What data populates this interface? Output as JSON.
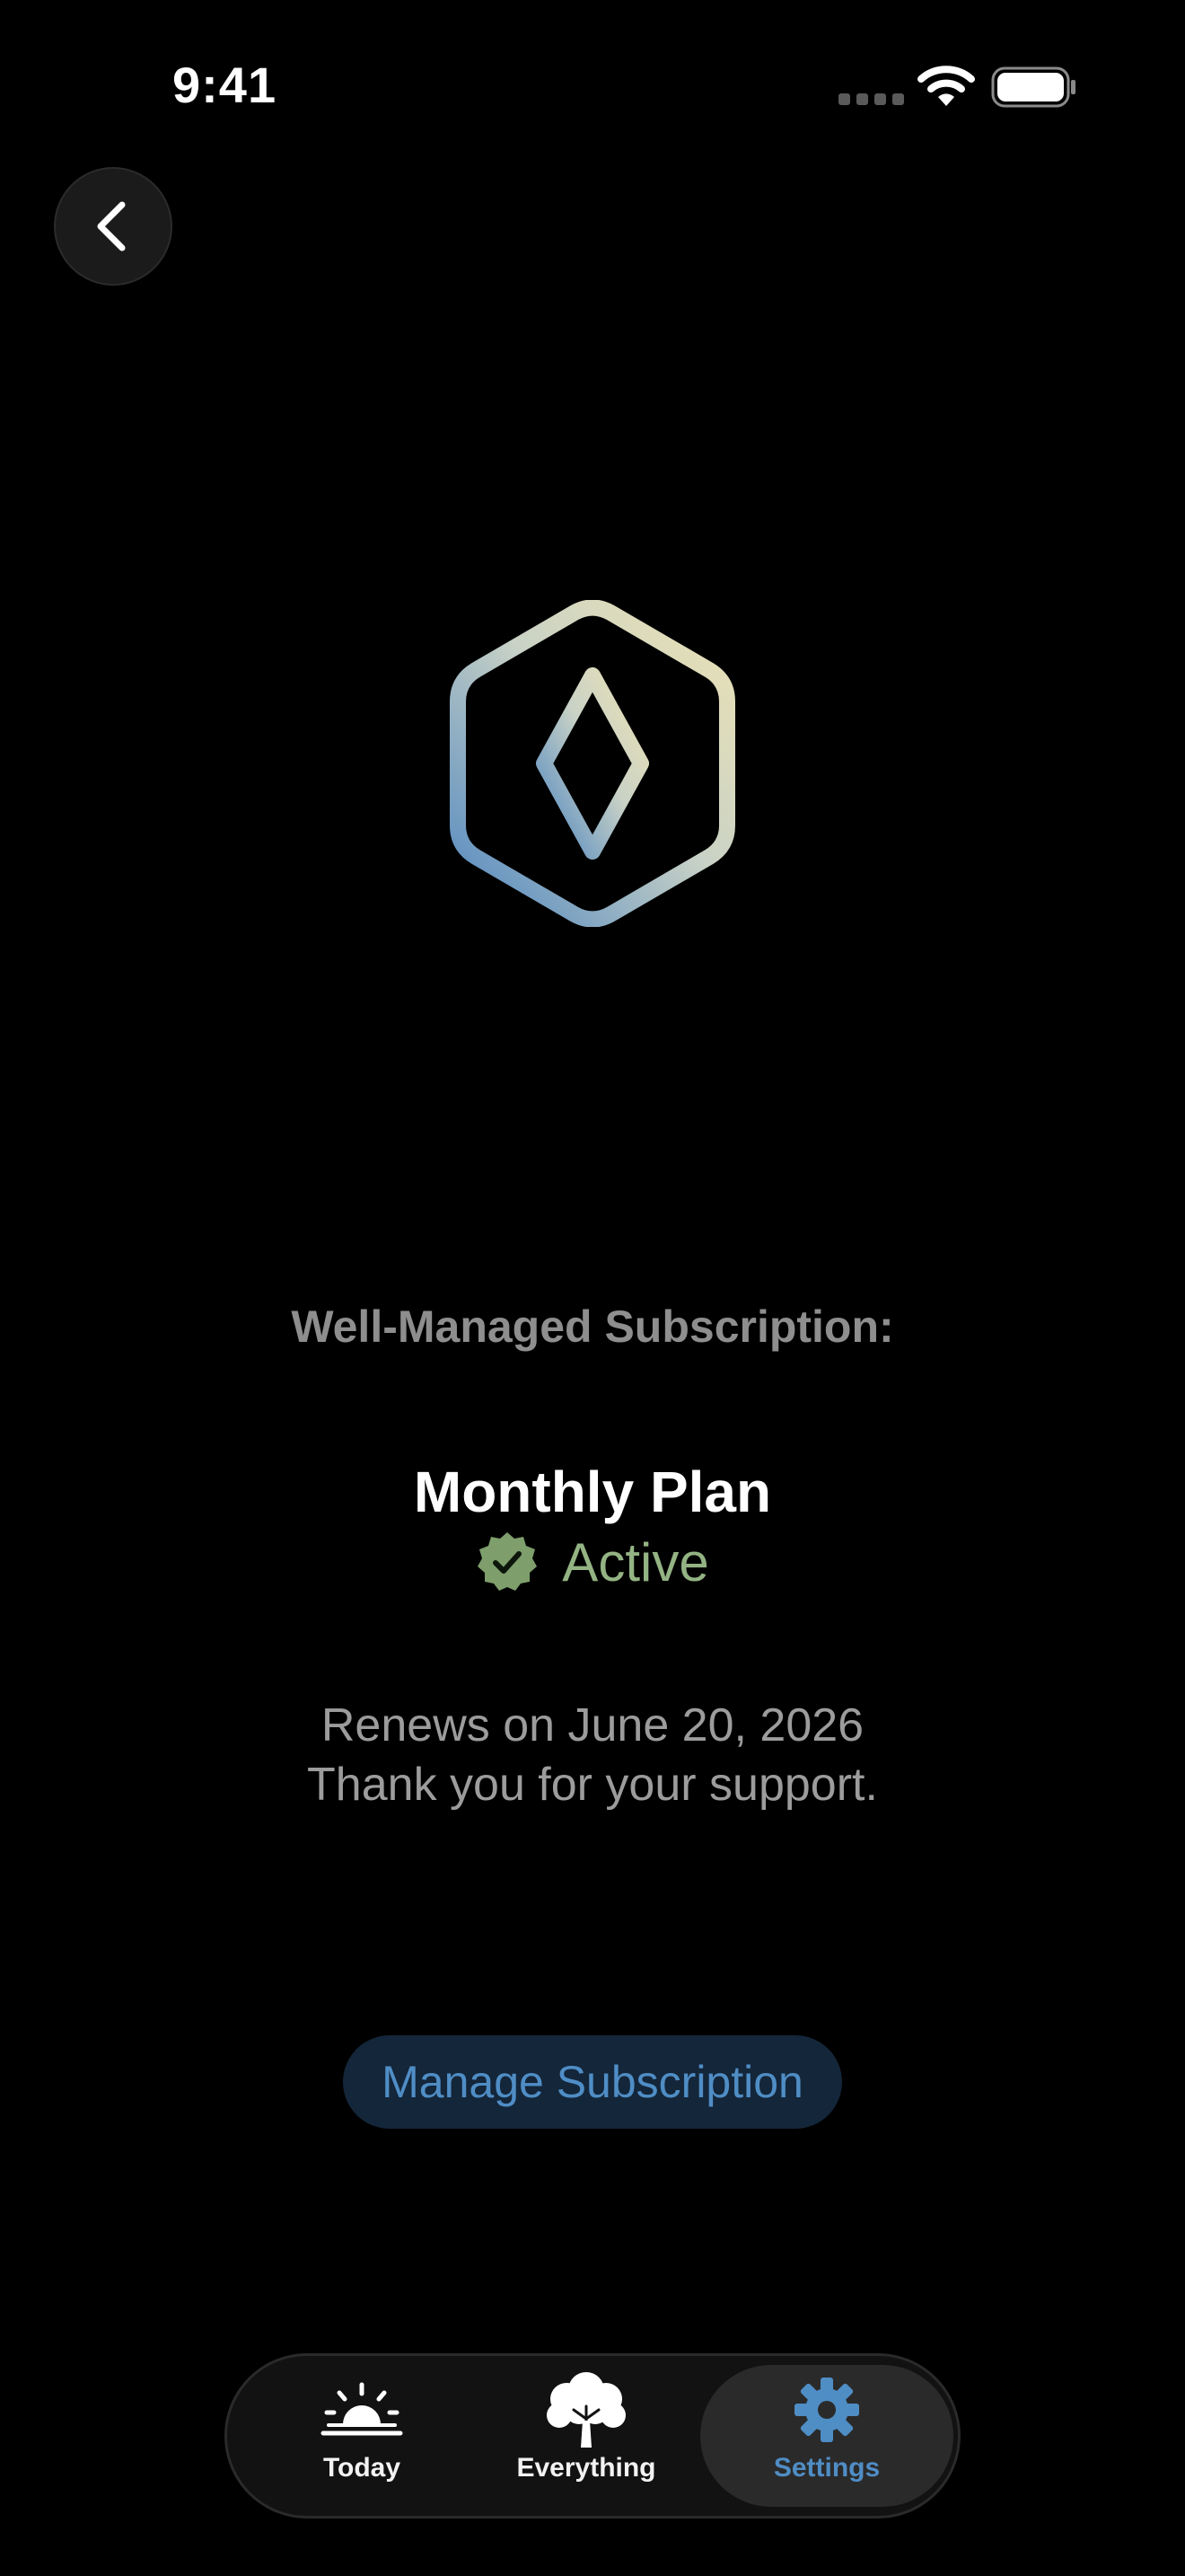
{
  "status_bar": {
    "time": "9:41"
  },
  "header": {
    "back_icon": "chevron-left-icon"
  },
  "logo": {
    "icon": "hexagon-diamond-logo",
    "gradient_colors": [
      "#4f86c0",
      "#e8e0b6"
    ]
  },
  "subscription": {
    "heading": "Well-Managed Subscription:",
    "plan_name": "Monthly Plan",
    "status_icon": "verified-check-badge-icon",
    "status": "Active",
    "status_color": "#93b383",
    "renewal": "Renews on June 20, 2026",
    "thanks": "Thank you for your support.",
    "manage_button": "Manage Subscription"
  },
  "tab_bar": {
    "tabs": [
      {
        "label": "Today",
        "icon": "sunrise-icon",
        "selected": false
      },
      {
        "label": "Everything",
        "icon": "tree-icon",
        "selected": false
      },
      {
        "label": "Settings",
        "icon": "gear-icon",
        "selected": true
      }
    ],
    "accent_color": "#4f8dc5"
  }
}
